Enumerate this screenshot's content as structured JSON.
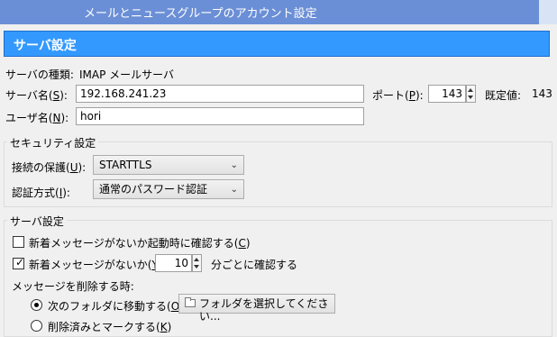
{
  "window": {
    "title": "メールとニュースグループのアカウント設定"
  },
  "header": {
    "title": "サーバ設定"
  },
  "server": {
    "type_label": "サーバの種類:",
    "type_value": "IMAP メールサーバ",
    "name_label_prefix": "サーバ名(",
    "name_label_key": "S",
    "name_label_suffix": "):",
    "name_value": "192.168.241.23",
    "port_label_prefix": "ポート(",
    "port_label_key": "P",
    "port_label_suffix": "):",
    "port_value": "143",
    "default_label": "既定値:",
    "default_value": "143",
    "user_label_prefix": "ユーザ名(",
    "user_label_key": "N",
    "user_label_suffix": "):",
    "user_value": "hori"
  },
  "security": {
    "group_title": "セキュリティ設定",
    "protection_label_prefix": "接続の保護(",
    "protection_label_key": "U",
    "protection_label_suffix": "):",
    "protection_value": "STARTTLS",
    "auth_label_prefix": "認証方式(",
    "auth_label_key": "I",
    "auth_label_suffix": "):",
    "auth_value": "通常のパスワード認証"
  },
  "server_settings": {
    "group_title": "サーバ設定",
    "check_startup_prefix": "新着メッセージがないか起動時に確認する(",
    "check_startup_key": "C",
    "check_startup_suffix": ")",
    "check_startup_checked": false,
    "check_interval_prefix": "新着メッセージがないか(",
    "check_interval_key": "Y",
    "check_interval_suffix": ")",
    "check_interval_checked": true,
    "interval_value": "10",
    "interval_suffix": "分ごとに確認する",
    "delete_label": "メッセージを削除する時:",
    "move_prefix": "次のフォルダに移動する(",
    "move_key": "O",
    "move_suffix": "):",
    "move_selected": true,
    "folder_select": "フォルダを選択してください...",
    "mark_prefix": "削除済みとマークする(",
    "mark_key": "K",
    "mark_suffix": ")"
  }
}
